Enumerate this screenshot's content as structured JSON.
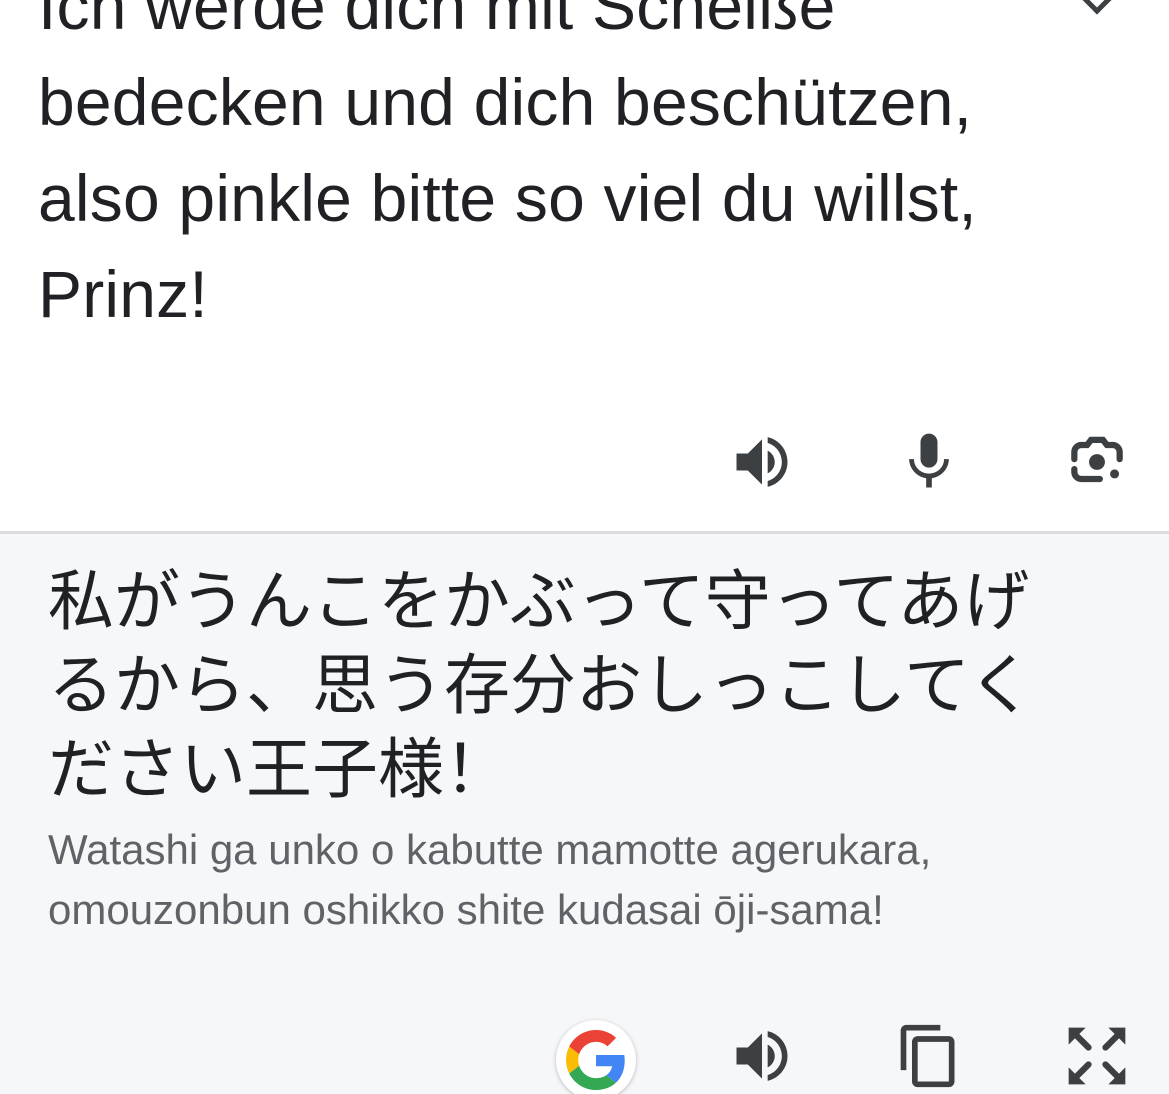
{
  "source": {
    "text": "Ich werde dich mit Scheiße bedecken und dich beschützen, also pinkle bitte so viel du willst, Prinz!",
    "clear_icon": "close-icon",
    "actions": [
      {
        "name": "listen-source-button",
        "icon": "volume-up-icon"
      },
      {
        "name": "voice-input-button",
        "icon": "microphone-icon"
      },
      {
        "name": "camera-translate-button",
        "icon": "google-lens-icon"
      }
    ]
  },
  "translation": {
    "text": "私がうんこをかぶって守ってあげるから、思う存分おしっこしてください王子様！",
    "romanization": "Watashi ga unko o kabutte mamotte agerukara, omouzonbun oshikko shite kudasai ōji-sama!",
    "actions": [
      {
        "name": "google-search-button",
        "icon": "google-g-icon"
      },
      {
        "name": "listen-translation-button",
        "icon": "volume-up-icon"
      },
      {
        "name": "copy-button",
        "icon": "copy-icon"
      },
      {
        "name": "fullscreen-button",
        "icon": "fullscreen-icon"
      }
    ]
  },
  "colors": {
    "text_primary": "#202124",
    "text_secondary": "#5f6368",
    "icon": "#3c4043",
    "target_background": "#f6f7f9",
    "divider": "#dadce0",
    "google_blue": "#4285F4",
    "google_red": "#EA4335",
    "google_yellow": "#FBBC05",
    "google_green": "#34A853"
  }
}
